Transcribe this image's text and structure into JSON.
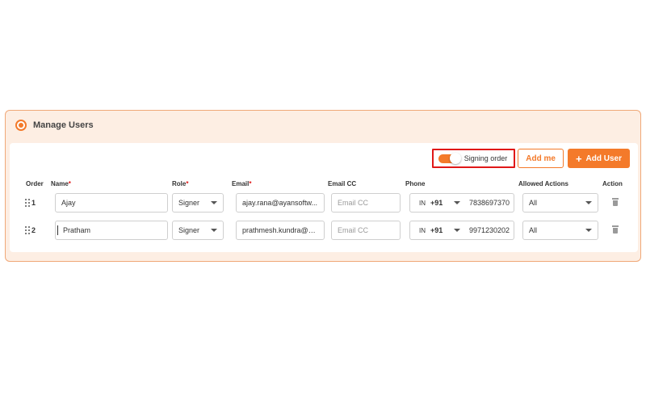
{
  "panel": {
    "title": "Manage Users"
  },
  "toolbar": {
    "signing_order_label": "Signing order",
    "signing_order_on": true,
    "add_me_label": "Add me",
    "add_user_label": "Add User"
  },
  "columns": {
    "order": "Order",
    "name": "Name",
    "role": "Role",
    "email": "Email",
    "email_cc": "Email CC",
    "phone": "Phone",
    "allowed_actions": "Allowed Actions",
    "action": "Action"
  },
  "required_mark": "*",
  "rows": [
    {
      "order": "1",
      "name": "Ajay",
      "role": "Signer",
      "email": "ajay.rana@ayansoftw...",
      "email_cc_placeholder": "Email CC",
      "country_code": "IN",
      "dial_code": "+91",
      "phone": "7838697370",
      "allowed_actions": "All"
    },
    {
      "order": "2",
      "name": "Pratham",
      "role": "Signer",
      "email": "prathmesh.kundra@a...",
      "email_cc_placeholder": "Email CC",
      "country_code": "IN",
      "dial_code": "+91",
      "phone": "9971230202",
      "allowed_actions": "All"
    }
  ],
  "colors": {
    "accent": "#f47a2a",
    "panel_bg": "#fdeee3",
    "highlight_border": "#e01818"
  }
}
